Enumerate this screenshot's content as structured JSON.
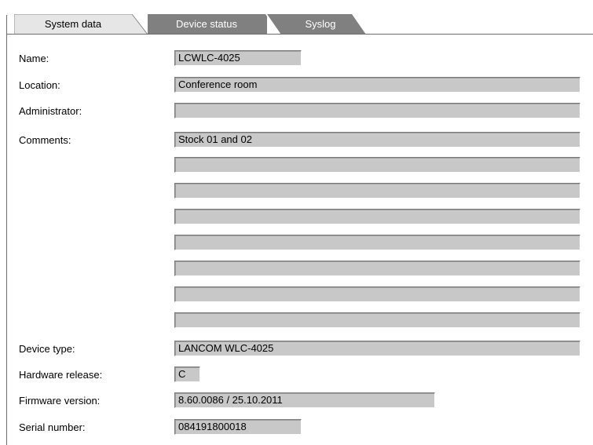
{
  "tabs": [
    {
      "label": "System data",
      "active": true
    },
    {
      "label": "Device status",
      "active": false
    },
    {
      "label": "Syslog",
      "active": false
    }
  ],
  "fields": {
    "name": {
      "label": "Name:",
      "value": "LCWLC-4025"
    },
    "location": {
      "label": "Location:",
      "value": "Conference room"
    },
    "administrator": {
      "label": "Administrator:",
      "value": ""
    },
    "comments": {
      "label": "Comments:",
      "lines": [
        "Stock 01 and 02",
        "",
        "",
        "",
        "",
        "",
        "",
        ""
      ]
    },
    "device_type": {
      "label": "Device type:",
      "value": "LANCOM WLC-4025"
    },
    "hardware_release": {
      "label": "Hardware release:",
      "value": "C"
    },
    "firmware_version": {
      "label": "Firmware version:",
      "value": "8.60.0086 / 25.10.2011"
    },
    "serial_number": {
      "label": "Serial number:",
      "value": "084191800018"
    }
  },
  "colors": {
    "tab_active": "#e6e6e6",
    "tab_inactive": "#808080",
    "field_bg": "#c8c8c8"
  }
}
